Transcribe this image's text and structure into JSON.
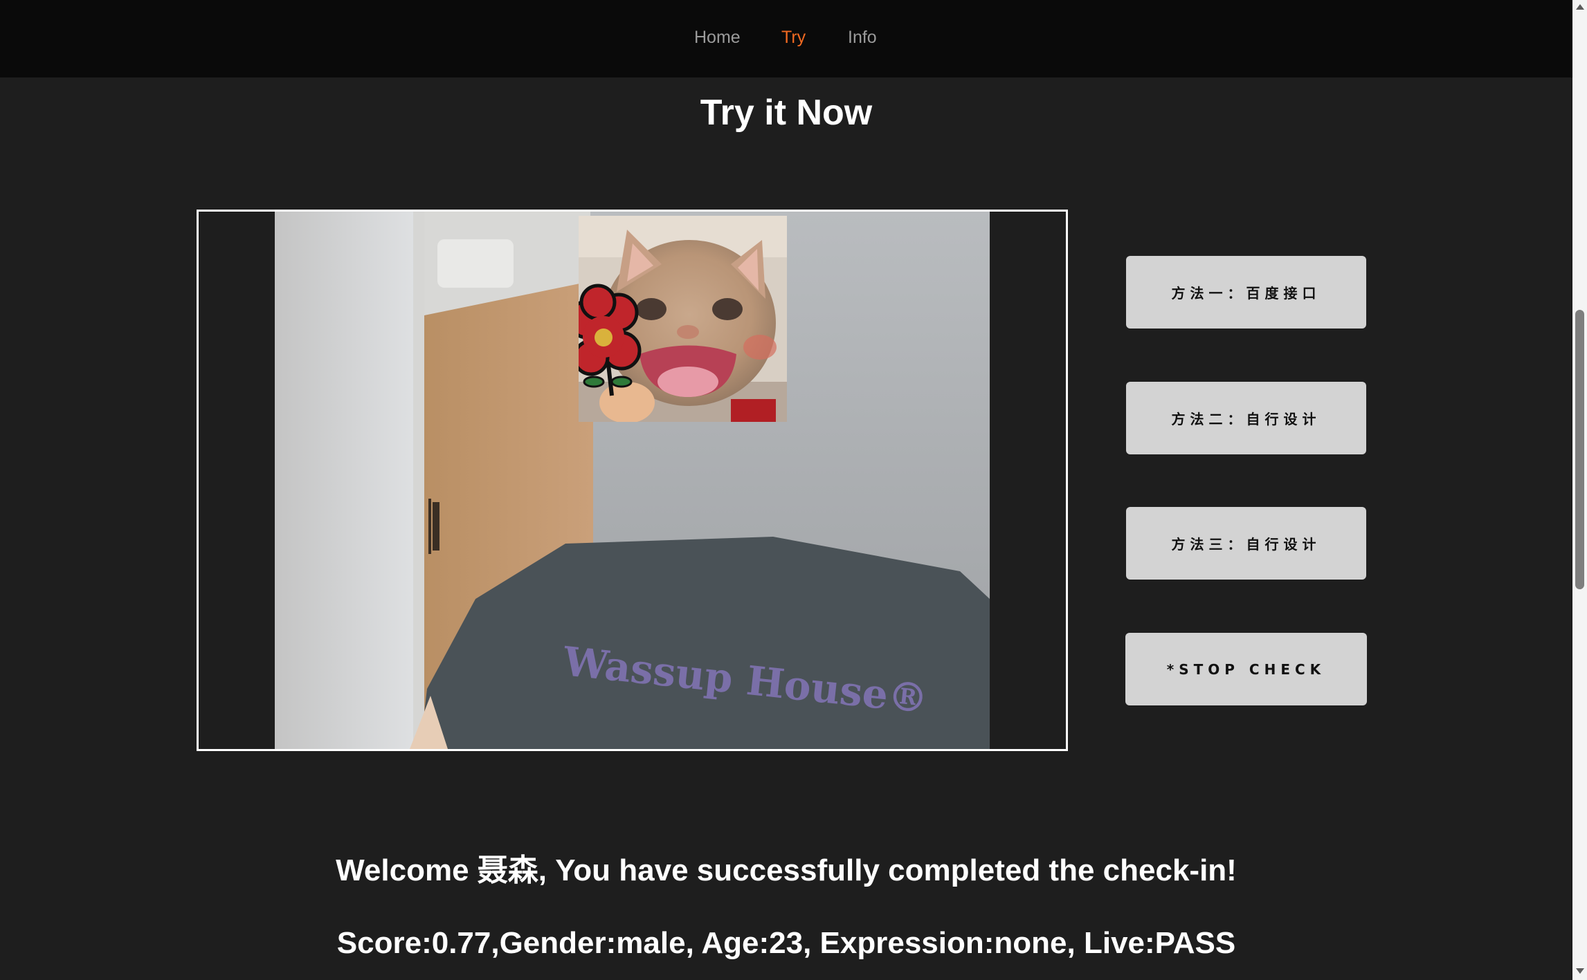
{
  "nav": {
    "items": [
      {
        "label": "Home",
        "active": false
      },
      {
        "label": "Try",
        "active": true
      },
      {
        "label": "Info",
        "active": false
      }
    ],
    "active_color": "#f26a21"
  },
  "page_title": "Try it Now",
  "camera": {
    "shirt_text": "Wassup House®",
    "overlay": "cat-face-sticker"
  },
  "buttons": {
    "method_1": "方法一：百度接口",
    "method_2": "方法二：自行设计",
    "method_3": "方法三：自行设计",
    "stop": "*STOP CHECK"
  },
  "result": {
    "welcome": "Welcome 聂森, You have successfully completed the check-in!",
    "details": "Score:0.77,Gender:male, Age:23, Expression:none, Live:PASS"
  },
  "colors": {
    "background": "#1e1e1e",
    "navbar": "#0a0a0a",
    "button": "#d3d3d3"
  }
}
